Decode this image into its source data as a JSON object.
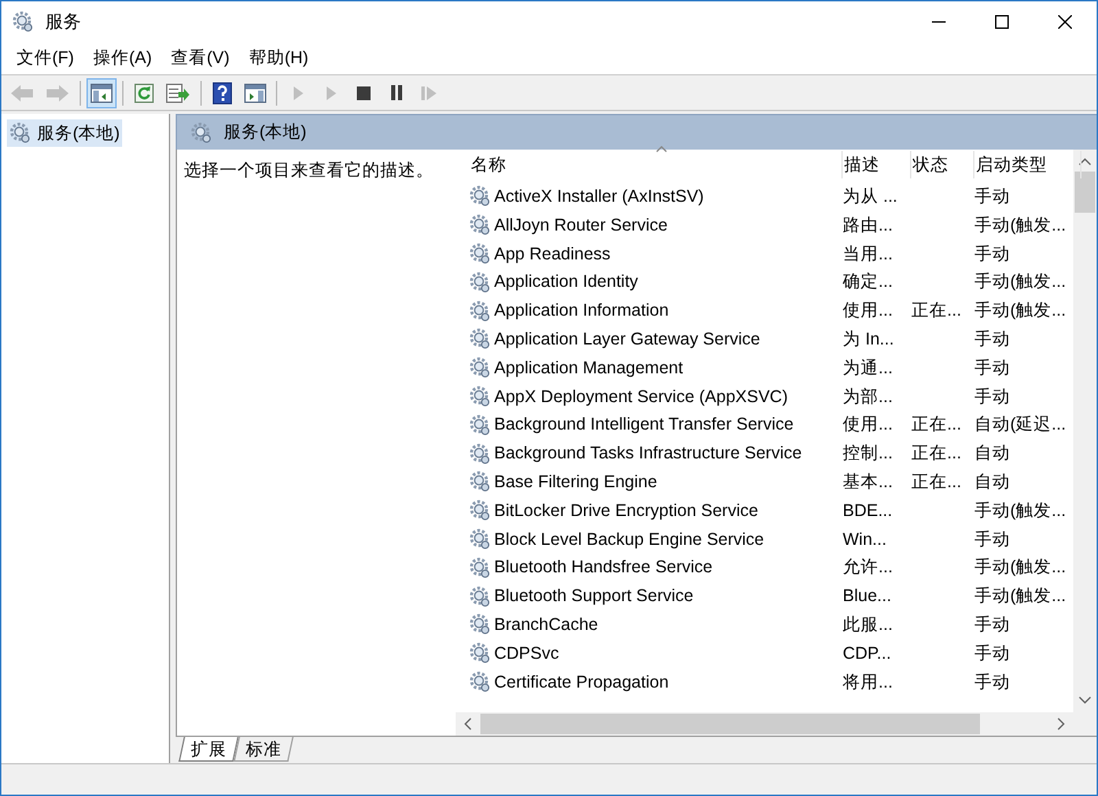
{
  "window": {
    "title": "服务"
  },
  "menu": [
    "文件(F)",
    "操作(A)",
    "查看(V)",
    "帮助(H)"
  ],
  "toolbar": [
    {
      "kind": "back",
      "disabled": true,
      "pressed": false
    },
    {
      "kind": "forward",
      "disabled": true,
      "pressed": false
    },
    {
      "kind": "sep"
    },
    {
      "kind": "tree",
      "disabled": false,
      "pressed": true
    },
    {
      "kind": "sep"
    },
    {
      "kind": "refresh",
      "disabled": false,
      "pressed": false
    },
    {
      "kind": "export",
      "disabled": false,
      "pressed": false
    },
    {
      "kind": "sep"
    },
    {
      "kind": "help",
      "disabled": false,
      "pressed": false
    },
    {
      "kind": "pane",
      "disabled": false,
      "pressed": false
    },
    {
      "kind": "sep"
    },
    {
      "kind": "play",
      "disabled": true,
      "pressed": false
    },
    {
      "kind": "play",
      "disabled": true,
      "pressed": false
    },
    {
      "kind": "stop",
      "disabled": false,
      "pressed": false
    },
    {
      "kind": "pause",
      "disabled": false,
      "pressed": false
    },
    {
      "kind": "resume",
      "disabled": true,
      "pressed": false
    }
  ],
  "sidebar": {
    "items": [
      {
        "label": "服务(本地)",
        "selected": true
      }
    ]
  },
  "panel": {
    "title": "服务(本地)",
    "description": "选择一个项目来查看它的描述。"
  },
  "table": {
    "columns": [
      {
        "label": "名称",
        "sorted": true
      },
      {
        "label": "描述",
        "sorted": false
      },
      {
        "label": "状态",
        "sorted": false
      },
      {
        "label": "启动类型",
        "sorted": false
      }
    ],
    "rows": [
      {
        "name": "ActiveX Installer (AxInstSV)",
        "description": "为从 ...",
        "startup_type": "手动"
      },
      {
        "name": "AllJoyn Router Service",
        "description": "路由...",
        "startup_type": "手动(触发..."
      },
      {
        "name": "App Readiness",
        "description": "当用...",
        "startup_type": "手动"
      },
      {
        "name": "Application Identity",
        "description": "确定...",
        "startup_type": "手动(触发..."
      },
      {
        "name": "Application Information",
        "description": "使用...",
        "status": "正在...",
        "startup_type": "手动(触发..."
      },
      {
        "name": "Application Layer Gateway Service",
        "description": "为 In...",
        "startup_type": "手动"
      },
      {
        "name": "Application Management",
        "description": "为通...",
        "startup_type": "手动"
      },
      {
        "name": "AppX Deployment Service (AppXSVC)",
        "description": "为部...",
        "startup_type": "手动"
      },
      {
        "name": "Background Intelligent Transfer Service",
        "description": "使用...",
        "status": "正在...",
        "startup_type": "自动(延迟..."
      },
      {
        "name": "Background Tasks Infrastructure Service",
        "description": "控制...",
        "status": "正在...",
        "startup_type": "自动"
      },
      {
        "name": "Base Filtering Engine",
        "description": "基本...",
        "status": "正在...",
        "startup_type": "自动"
      },
      {
        "name": "BitLocker Drive Encryption Service",
        "description": "BDE...",
        "startup_type": "手动(触发..."
      },
      {
        "name": "Block Level Backup Engine Service",
        "description": "Win...",
        "startup_type": "手动"
      },
      {
        "name": "Bluetooth Handsfree Service",
        "description": "允许...",
        "startup_type": "手动(触发..."
      },
      {
        "name": "Bluetooth Support Service",
        "description": "Blue...",
        "startup_type": "手动(触发..."
      },
      {
        "name": "BranchCache",
        "description": "此服...",
        "startup_type": "手动"
      },
      {
        "name": "CDPSvc",
        "description": "CDP...",
        "startup_type": "手动"
      },
      {
        "name": "Certificate Propagation",
        "description": "将用...",
        "startup_type": "手动"
      }
    ]
  },
  "tabs": [
    {
      "label": "扩展",
      "selected": true
    },
    {
      "label": "标准",
      "selected": false
    }
  ]
}
